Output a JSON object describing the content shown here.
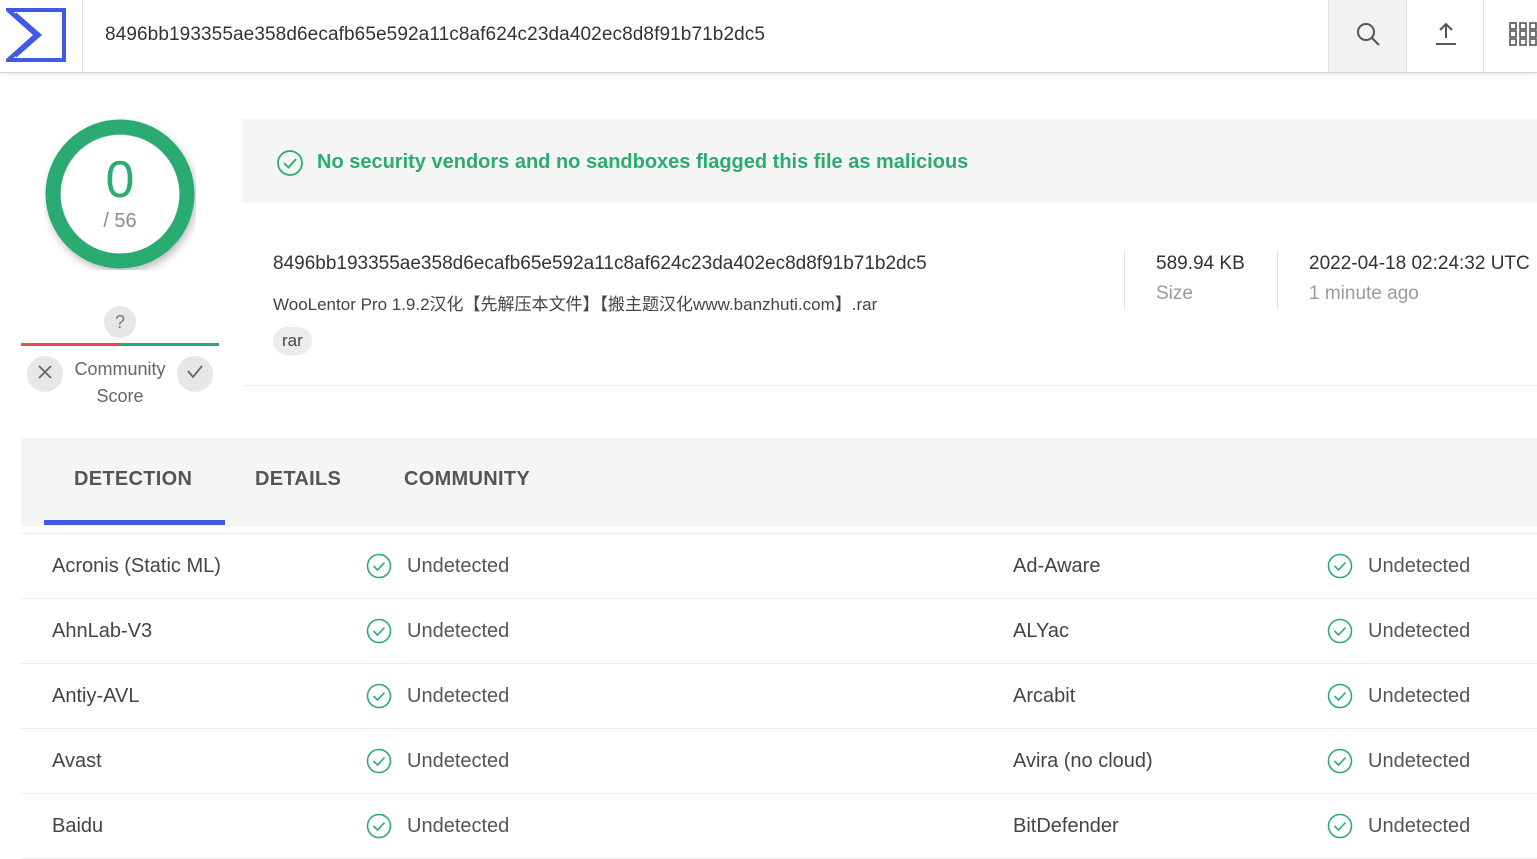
{
  "header": {
    "search_value": "8496bb193355ae358d6ecafb65e592a11c8af624c23da402ec8d8f91b71b2dc5",
    "icons": [
      "virustotal-logo",
      "search-icon",
      "upload-icon",
      "apps-grid-icon"
    ]
  },
  "score": {
    "detections": "0",
    "total": "/ 56",
    "color": "#2bab71"
  },
  "community": {
    "question": "?",
    "label_line1": "Community",
    "label_line2": "Score"
  },
  "summary": {
    "message": "No security vendors and no sandboxes flagged this file as malicious"
  },
  "file": {
    "hash": "8496bb193355ae358d6ecafb65e592a11c8af624c23da402ec8d8f91b71b2dc5",
    "name": "WooLentor Pro 1.9.2汉化【先解压本文件】【搬主题汉化www.banzhuti.com】.rar",
    "tag": "rar",
    "size": "589.94 KB",
    "size_label": "Size",
    "date": "2022-04-18 02:24:32 UTC",
    "date_label": "1 minute ago"
  },
  "tabs": [
    {
      "label": "DETECTION",
      "active": true
    },
    {
      "label": "DETAILS",
      "active": false
    },
    {
      "label": "COMMUNITY",
      "active": false
    }
  ],
  "detections": [
    {
      "left": {
        "vendor": "Acronis (Static ML)",
        "status": "Undetected"
      },
      "right": {
        "vendor": "Ad-Aware",
        "status": "Undetected"
      }
    },
    {
      "left": {
        "vendor": "AhnLab-V3",
        "status": "Undetected"
      },
      "right": {
        "vendor": "ALYac",
        "status": "Undetected"
      }
    },
    {
      "left": {
        "vendor": "Antiy-AVL",
        "status": "Undetected"
      },
      "right": {
        "vendor": "Arcabit",
        "status": "Undetected"
      }
    },
    {
      "left": {
        "vendor": "Avast",
        "status": "Undetected"
      },
      "right": {
        "vendor": "Avira (no cloud)",
        "status": "Undetected"
      }
    },
    {
      "left": {
        "vendor": "Baidu",
        "status": "Undetected"
      },
      "right": {
        "vendor": "BitDefender",
        "status": "Undetected"
      }
    }
  ],
  "colors": {
    "accent": "#3f5ae8",
    "clean": "#2bab71",
    "malicious": "#ea4b5b"
  }
}
